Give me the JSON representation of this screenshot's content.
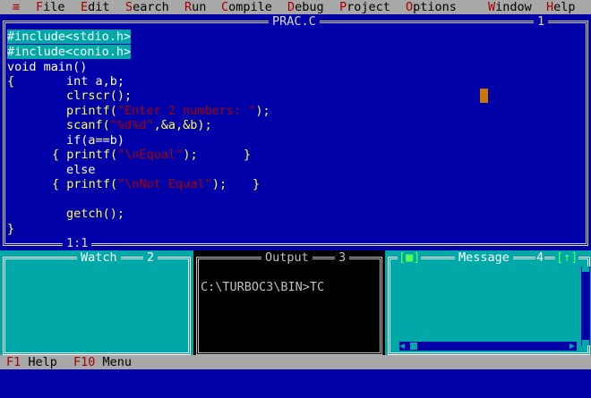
{
  "menu": {
    "system": "≡",
    "items": [
      {
        "hot": "F",
        "rest": "ile"
      },
      {
        "hot": "E",
        "rest": "dit"
      },
      {
        "hot": "S",
        "rest": "earch"
      },
      {
        "hot": "R",
        "rest": "un"
      },
      {
        "hot": "C",
        "rest": "ompile"
      },
      {
        "hot": "D",
        "rest": "ebug"
      },
      {
        "hot": "P",
        "rest": "roject"
      },
      {
        "hot": "O",
        "rest": "ptions"
      },
      {
        "hot": "W",
        "rest": "indow"
      },
      {
        "hot": "H",
        "rest": "elp"
      }
    ]
  },
  "editor": {
    "close_glyph": "[■]",
    "title": "PRAC.C",
    "window_number": "1",
    "cursor_pos": "1:1",
    "lines": {
      "l1": "#include<stdio.h>",
      "l2": "#include<conio.h>",
      "l3": "void main()",
      "l4a": "{",
      "l4b": "int a,b;",
      "l5": "clrscr();",
      "l6a": "printf(",
      "l6s": "\"Enter 2 numbers: \"",
      "l6b": ");",
      "l7a": "scanf(",
      "l7s": "\"%d%d\"",
      "l7b": ",&a,&b);",
      "l8": "if(a==b)",
      "l9a": "{ printf(",
      "l9s": "\"\\nEqual\"",
      "l9b": ");",
      "l9c": "}",
      "l10": "else",
      "l11a": "{ printf(",
      "l11s": "\"\\nNot Equal\"",
      "l11b": ");",
      "l11c": "}",
      "l12": "getch();",
      "l13": "}"
    }
  },
  "watch": {
    "title": "Watch",
    "number": "2"
  },
  "output": {
    "title": "Output",
    "number": "3",
    "text": "C:\\TURBOC3\\BIN>TC"
  },
  "message": {
    "title": "Message",
    "number": "4",
    "close_glyph": "[■]",
    "zoom_glyph": "[↑]"
  },
  "status": {
    "items": [
      {
        "key": "F1",
        "label": "Help"
      },
      {
        "key": "F10",
        "label": "Menu"
      }
    ]
  },
  "colors": {
    "desktop_blue": "#0000a8",
    "menu_gray": "#a8a8a8",
    "hotkey_red": "#a80000",
    "code_yellow": "#ffff55",
    "cyan": "#00a8a8"
  }
}
